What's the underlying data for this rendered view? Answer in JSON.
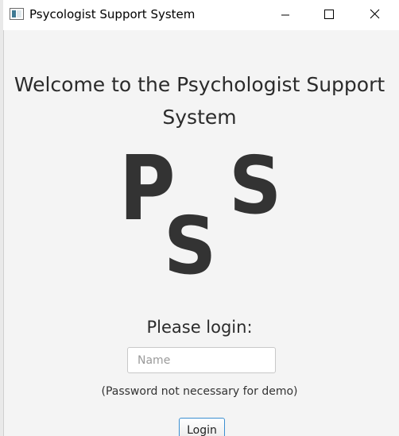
{
  "window": {
    "title": "Psycologist Support System",
    "icon": "app-window-icon",
    "controls": [
      "minimize-icon",
      "maximize-icon",
      "close-icon"
    ]
  },
  "main": {
    "welcome_line1": "Welcome to the Psychologist Support",
    "welcome_line2": "System",
    "logo": {
      "letters": [
        "P",
        "S",
        "S"
      ],
      "color": "#333333"
    },
    "please_login": "Please login:",
    "name_input": {
      "value": "",
      "placeholder": "Name"
    },
    "password_note": "(Password not necessary for demo)",
    "login_button": "Login"
  },
  "colors": {
    "background": "#f4f4f4",
    "titlebar": "#ffffff",
    "focus_border": "#3c8fd1"
  }
}
